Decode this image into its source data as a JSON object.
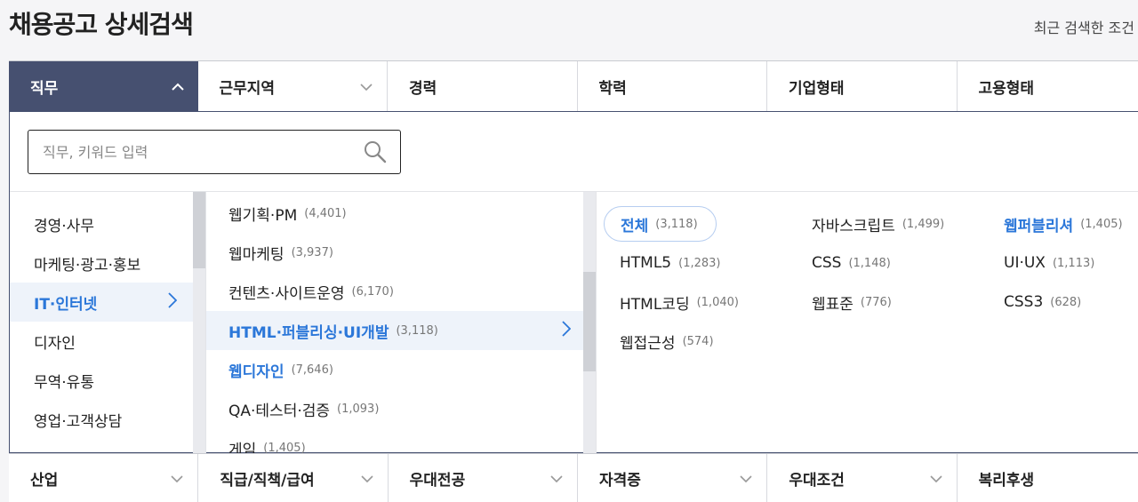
{
  "page": {
    "title": "채용공고 상세검색",
    "recent_search": "최근 검색한 조건"
  },
  "top_tabs": [
    {
      "label": "직무",
      "expanded": true
    },
    {
      "label": "근무지역"
    },
    {
      "label": "경력"
    },
    {
      "label": "학력"
    },
    {
      "label": "기업형태"
    },
    {
      "label": "고용형태"
    }
  ],
  "search": {
    "placeholder": "직무, 키워드 입력",
    "value": ""
  },
  "categories": [
    {
      "label": "경영·사무"
    },
    {
      "label": "마케팅·광고·홍보"
    },
    {
      "label": "IT·인터넷",
      "active": true
    },
    {
      "label": "디자인"
    },
    {
      "label": "무역·유통"
    },
    {
      "label": "영업·고객상담"
    }
  ],
  "subcategories": [
    {
      "label": "웹기획·PM",
      "count": "(4,401)"
    },
    {
      "label": "웹마케팅",
      "count": "(3,937)"
    },
    {
      "label": "컨텐츠·사이트운영",
      "count": "(6,170)"
    },
    {
      "label": "HTML·퍼블리싱·UI개발",
      "count": "(3,118)",
      "active": true
    },
    {
      "label": "웹디자인",
      "count": "(7,646)",
      "highlight": true
    },
    {
      "label": "QA·테스터·검증",
      "count": "(1,093)"
    },
    {
      "label": "게임",
      "count": "(1,405)"
    }
  ],
  "keywords": [
    {
      "label": "전체",
      "count": "(3,118)",
      "selected": true
    },
    {
      "label": "자바스크립트",
      "count": "(1,499)"
    },
    {
      "label": "웹퍼블리셔",
      "count": "(1,405)",
      "highlight": true
    },
    {
      "label": "HTML5",
      "count": "(1,283)"
    },
    {
      "label": "CSS",
      "count": "(1,148)"
    },
    {
      "label": "UI·UX",
      "count": "(1,113)"
    },
    {
      "label": "HTML코딩",
      "count": "(1,040)"
    },
    {
      "label": "웹표준",
      "count": "(776)"
    },
    {
      "label": "CSS3",
      "count": "(628)"
    },
    {
      "label": "웹접근성",
      "count": "(574)"
    }
  ],
  "bottom_tabs": [
    {
      "label": "산업"
    },
    {
      "label": "직급/직책/급여"
    },
    {
      "label": "우대전공"
    },
    {
      "label": "자격증"
    },
    {
      "label": "우대조건"
    },
    {
      "label": "복리후생"
    }
  ],
  "colors": {
    "active_tab_bg": "#465070",
    "accent_blue": "#2b77d9",
    "active_row_bg": "#eef3fa"
  }
}
